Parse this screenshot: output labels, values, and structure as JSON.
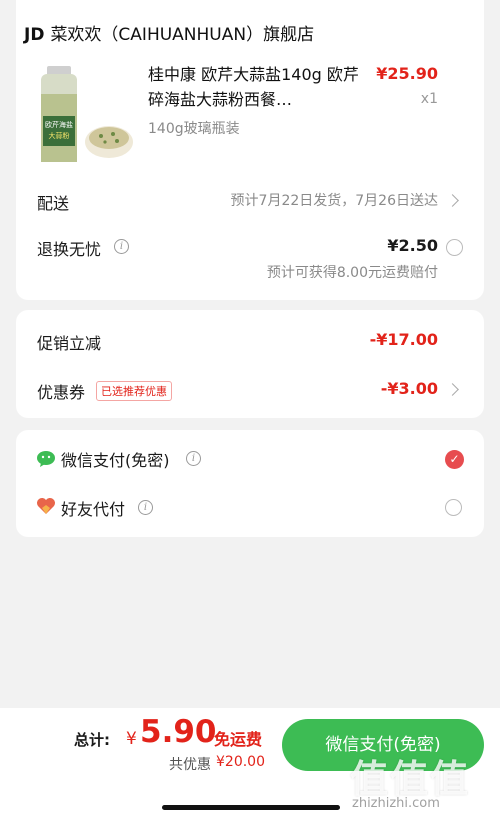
{
  "store": {
    "brand": "JD",
    "name": "菜欢欢（CAIHUANHUAN）旗舰店"
  },
  "product": {
    "title": "桂中康 欧芹大蒜盐140g 欧芹碎海盐大蒜粉西餐…",
    "variant": "140g玻璃瓶装",
    "price": "¥25.90",
    "qty": "x1",
    "image_text": "欧芹海盐大蒜粉"
  },
  "delivery": {
    "label": "配送",
    "value": "预计7月22日发货，7月26日送达"
  },
  "returns": {
    "label": "退换无忧",
    "price": "¥2.50",
    "note": "预计可获得8.00元运费赔付"
  },
  "promo": {
    "label": "促销立减",
    "value": "-¥17.00"
  },
  "coupon": {
    "label": "优惠券",
    "tag": "已选推荐优惠",
    "value": "-¥3.00"
  },
  "payment": {
    "wechat": "微信支付(免密)",
    "friend": "好友代付"
  },
  "footer": {
    "total_label": "总计:",
    "total_currency": "¥",
    "total_value": "5.90",
    "free_shipping": "免运费",
    "discount_label": "共优惠",
    "discount_value": "¥20.00",
    "pay_button": "微信支付(免密)"
  },
  "watermark": {
    "text": "值值值",
    "url": "zhizhizhi.com"
  },
  "colors": {
    "accent_red": "#e2231a",
    "wechat_green": "#3dbc54",
    "radio_selected": "#e74c4f"
  }
}
